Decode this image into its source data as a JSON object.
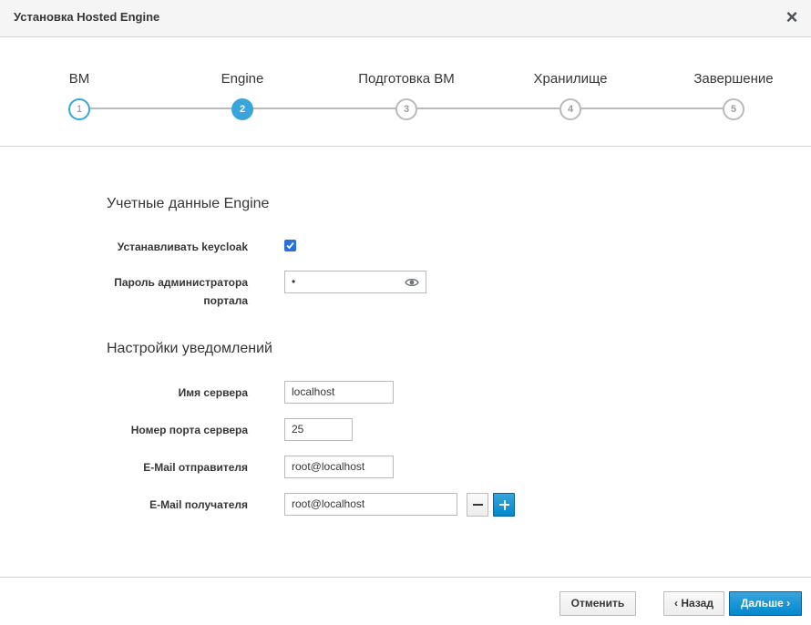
{
  "dialog": {
    "title": "Установка Hosted Engine",
    "close_icon": "close-icon"
  },
  "wizard": {
    "active_step": 2,
    "steps": [
      {
        "number": "1",
        "label": "ВМ",
        "state": "done"
      },
      {
        "number": "2",
        "label": "Engine",
        "state": "active"
      },
      {
        "number": "3",
        "label": "Подготовка ВМ",
        "state": "pending"
      },
      {
        "number": "4",
        "label": "Хранилище",
        "state": "pending"
      },
      {
        "number": "5",
        "label": "Завершение",
        "state": "pending"
      }
    ]
  },
  "engine_credentials": {
    "section_title": "Учетные данные Engine",
    "keycloak_label": "Устанавливать keycloak",
    "keycloak_checked": true,
    "password_label_line1": "Пароль администратора",
    "password_label_line2": "портала",
    "password_value": "•"
  },
  "notifications": {
    "section_title": "Настройки уведомлений",
    "server_name_label": "Имя сервера",
    "server_name_value": "localhost",
    "port_label": "Номер порта сервера",
    "port_value": "25",
    "sender_label": "E-Mail отправителя",
    "sender_value": "root@localhost",
    "recipient_label": "E-Mail получателя",
    "recipient_value": "root@localhost"
  },
  "footer": {
    "cancel_label": "Отменить",
    "back_label": "‹ Назад",
    "next_label": "Дальше ›"
  },
  "colors": {
    "accent": "#39a5dc",
    "primary_button": "#0088ce",
    "checkbox": "#2b6fde"
  }
}
